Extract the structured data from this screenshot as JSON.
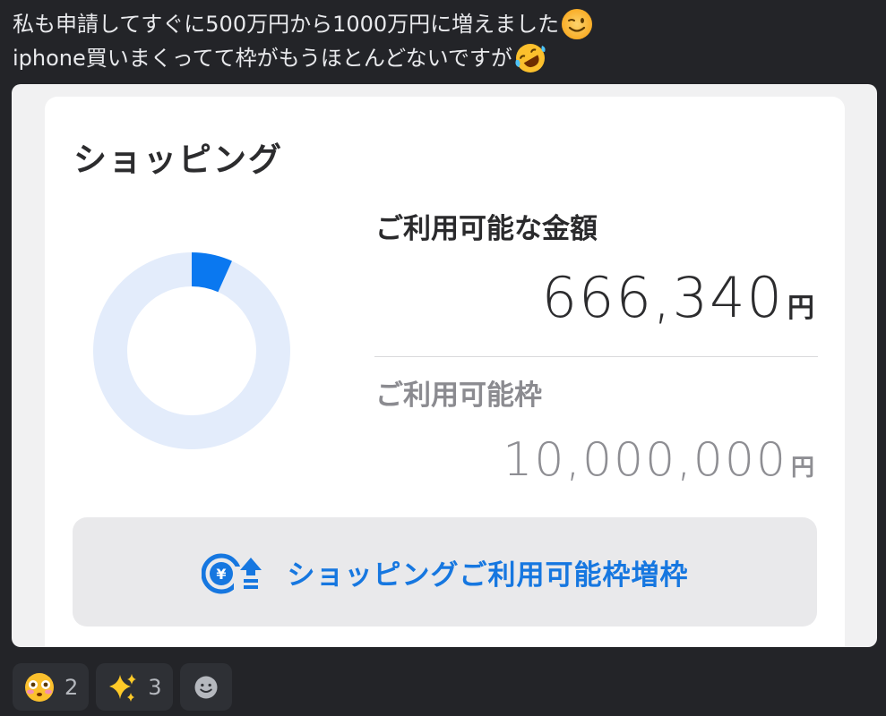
{
  "message": {
    "line1": "私も申請してすぐに500万円から1000万円に増えました",
    "line1_emoji": "winking-face-emoji",
    "line2": "iphone買いまくってて枠がもうほとんどないですが",
    "line2_emoji": "rolling-laughing-emoji"
  },
  "card": {
    "title": "ショッピング",
    "available_label": "ご利用可能な金額",
    "available_amount": "666,340",
    "currency": "円",
    "limit_label": "ご利用可能枠",
    "limit_amount": "10,000,000",
    "usage_fraction": 0.067,
    "colors": {
      "ring_track": "#e3ecfb",
      "ring_fill": "#0a78f0",
      "accent": "#1677e0"
    },
    "increase_button_label": "ショッピングご利用可能枠増枠",
    "increase_button_icon": "yen-up-arrow-icon"
  },
  "reactions": [
    {
      "emoji": "flushed-face-emoji",
      "count": "2"
    },
    {
      "emoji": "sparkles-emoji",
      "count": "3"
    }
  ],
  "add_reaction_icon": "add-reaction-icon"
}
